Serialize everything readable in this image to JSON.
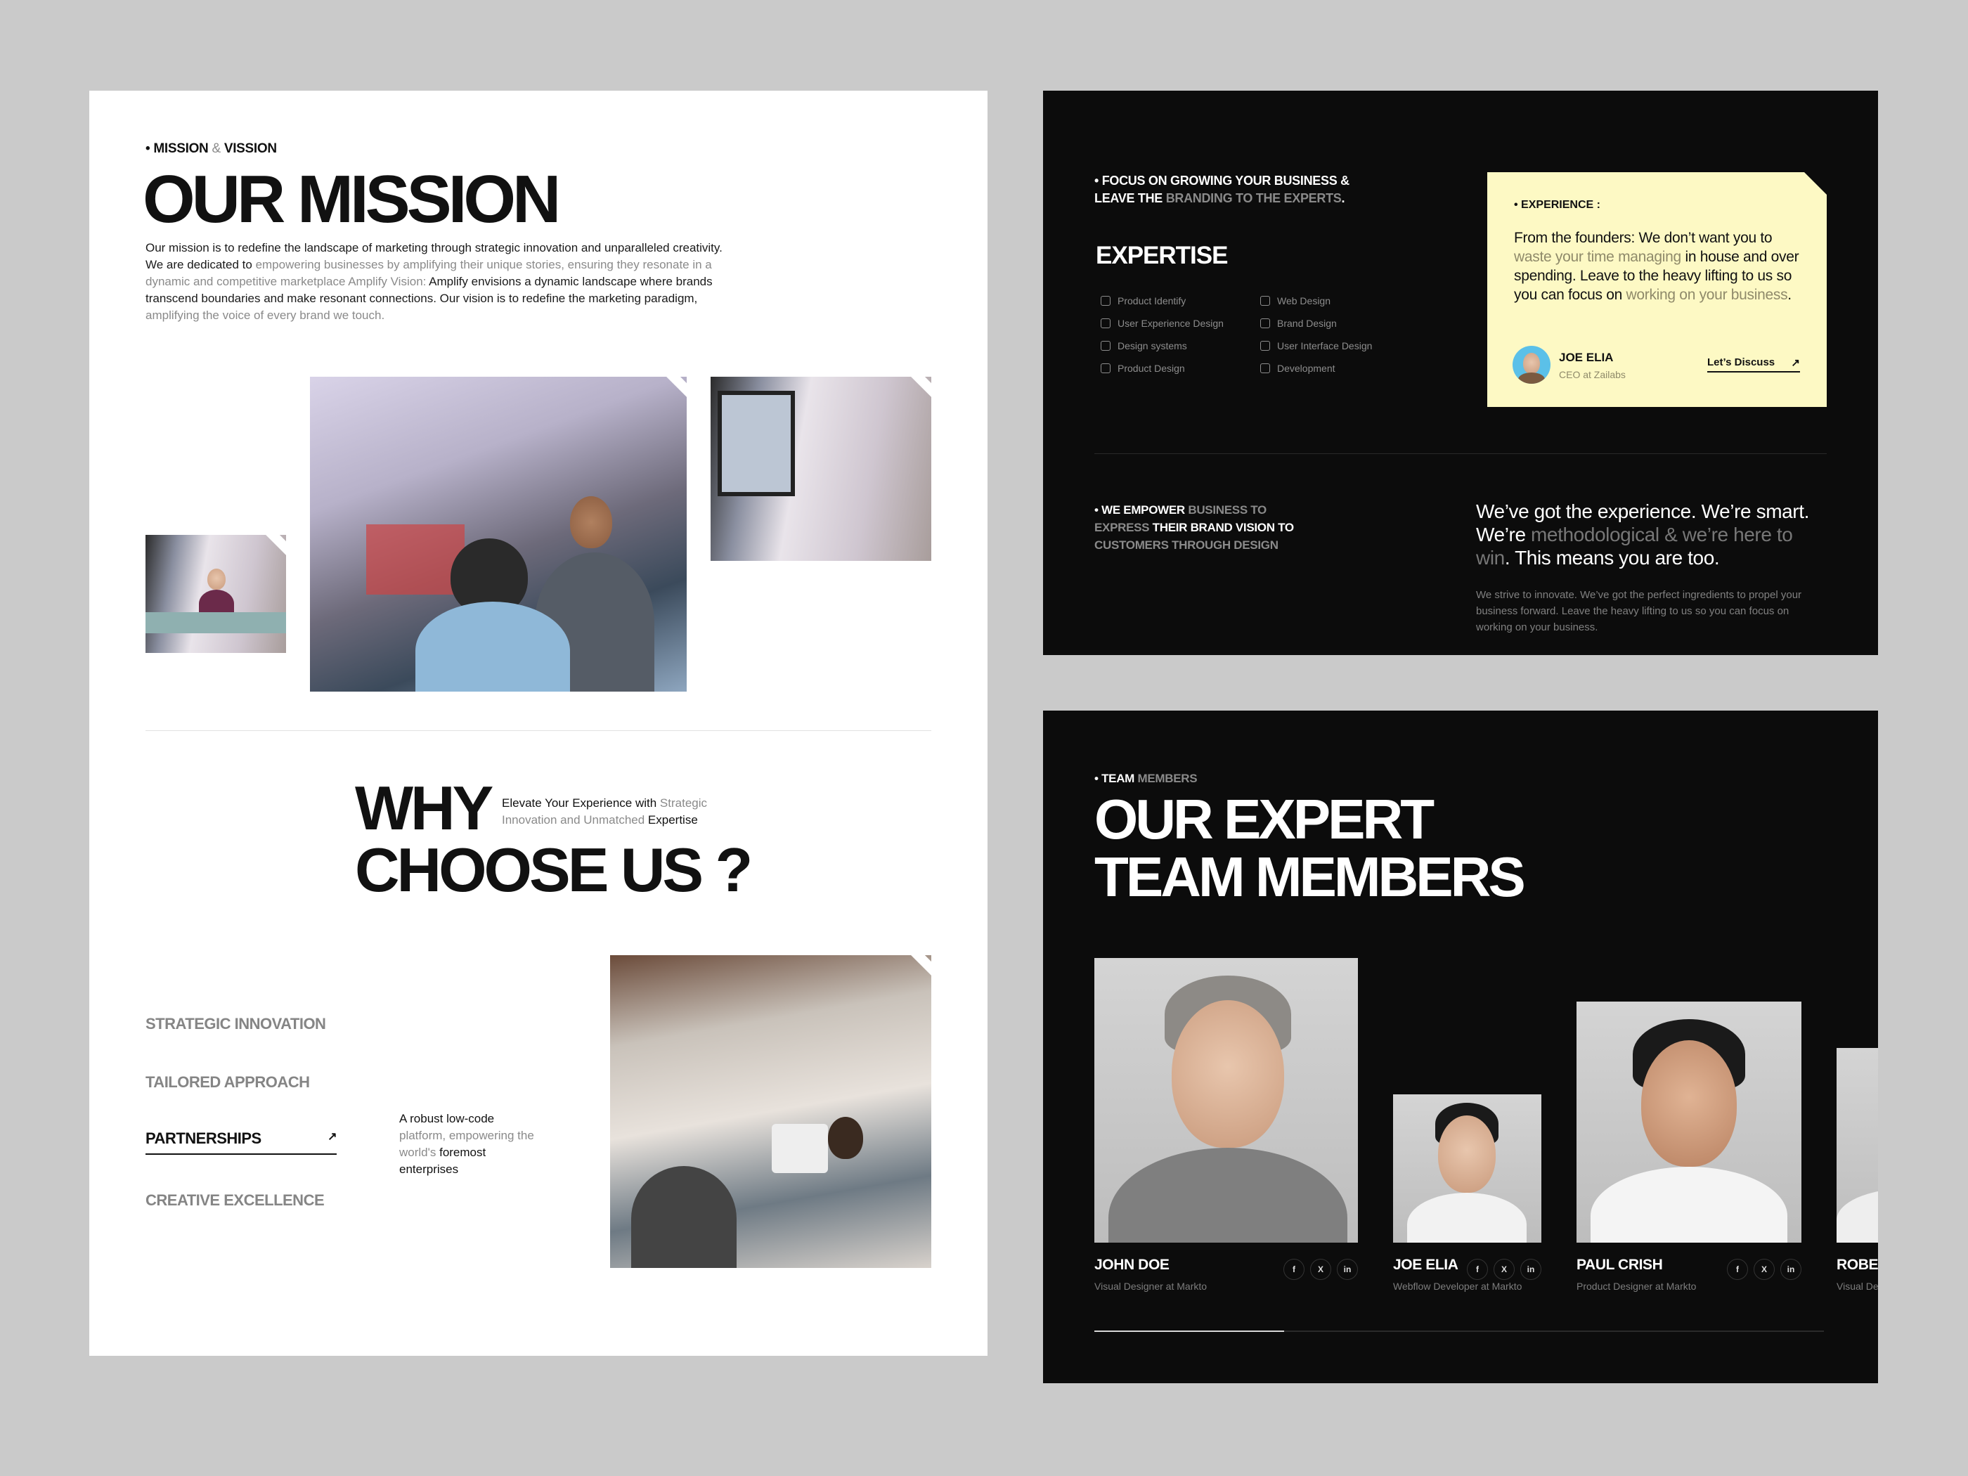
{
  "mission": {
    "eyebrow_a": "MISSION",
    "eyebrow_amp": "&",
    "eyebrow_b": "VISSION",
    "title": "OUR MISSION",
    "paragraph": [
      {
        "t": "Our mission is to redefine the landscape of marketing through strategic innovation and unparalleled creativity. We are dedicated to ",
        "muted": false
      },
      {
        "t": "empowering businesses by amplifying their unique stories, ensuring they resonate in a dynamic and competitive marketplace Amplify Vision: ",
        "muted": true
      },
      {
        "t": "Amplify envisions a dynamic landscape where brands transcend boundaries and make resonant connections. Our vision is to redefine the marketing paradigm, ",
        "muted": false
      },
      {
        "t": "amplifying the voice of every brand we touch.",
        "muted": true
      }
    ]
  },
  "why": {
    "title_line1": "WHY",
    "title_line2": "CHOOSE US ?",
    "subtitle_a": "Elevate Your Experience with ",
    "subtitle_b": "Strategic Innovation and Unmatched ",
    "subtitle_c": "Expertise",
    "items": [
      {
        "label": "STRATEGIC INNOVATION",
        "active": false
      },
      {
        "label": "TAILORED APPROACH",
        "active": false
      },
      {
        "label": "PARTNERSHIPS",
        "active": true
      },
      {
        "label": "CREATIVE EXCELLENCE",
        "active": false
      }
    ],
    "arrow": "↗",
    "desc_a": "A robust low-code ",
    "desc_b": "platform, empowering the world's ",
    "desc_c": "foremost enterprises"
  },
  "expertise": {
    "eyebrow_a": "FOCUS ON GROWING YOUR BUSINESS & LEAVE THE ",
    "eyebrow_b": "BRANDING TO THE EXPERTS",
    "eyebrow_c": ".",
    "title": "EXPERTISE",
    "items": [
      {
        "label": "Product Identify",
        "icon": "document-icon"
      },
      {
        "label": "Web Design",
        "icon": "cursor-icon"
      },
      {
        "label": "User Experience Design",
        "icon": "brain-icon"
      },
      {
        "label": "Brand Design",
        "icon": "palette-icon"
      },
      {
        "label": "Design systems",
        "icon": "target-icon"
      },
      {
        "label": "User Interface Design",
        "icon": "brush-icon"
      },
      {
        "label": "Product Design",
        "icon": "box-icon"
      },
      {
        "label": "Development",
        "icon": "code-icon"
      }
    ],
    "card": {
      "eyebrow": "EXPERIENCE :",
      "quote_a": "From the founders:  We don’t want you to ",
      "quote_b": "waste your time managing",
      "quote_c": " in house and over spending. Leave to the heavy lifting to us so you can focus on ",
      "quote_d": "working on your business",
      "quote_e": ".",
      "name": "JOE ELIA",
      "role": "CEO at Zailabs",
      "cta": "Let’s Discuss",
      "cta_arrow": "↗",
      "bg": "#fdf9c4"
    },
    "empower_a": "WE EMPOWER ",
    "empower_b": "BUSINESS TO EXPRESS ",
    "empower_c": "THEIR BRAND VISION TO ",
    "empower_d": "CUSTOMERS THROUGH DESIGN",
    "statement_a": "We’ve got the experience. We’re smart. We’re ",
    "statement_b": "methodological & we’re here to win",
    "statement_c": ". This means you are too.",
    "body": "We strive to innovate. We’ve got the perfect ingredients to propel your business forward. Leave the heavy lifting to us so you can focus on working on your business."
  },
  "team": {
    "eyebrow_a": "TEAM",
    "eyebrow_b": "MEMBERS",
    "title_line1": "OUR EXPERT",
    "title_line2": "TEAM MEMBERS",
    "members": [
      {
        "name": "JOHN DOE",
        "role": "Visual Designer at Markto"
      },
      {
        "name": "JOE ELIA",
        "role": "Webflow Developer at Markto"
      },
      {
        "name": "PAUL CRISH",
        "role": "Product Designer at Markto"
      },
      {
        "name": "ROBERT",
        "role": "Visual Designer at Markto"
      }
    ],
    "social": {
      "facebook": "f",
      "x": "X",
      "linkedin": "in"
    },
    "carousel_progress_percent": 26
  }
}
